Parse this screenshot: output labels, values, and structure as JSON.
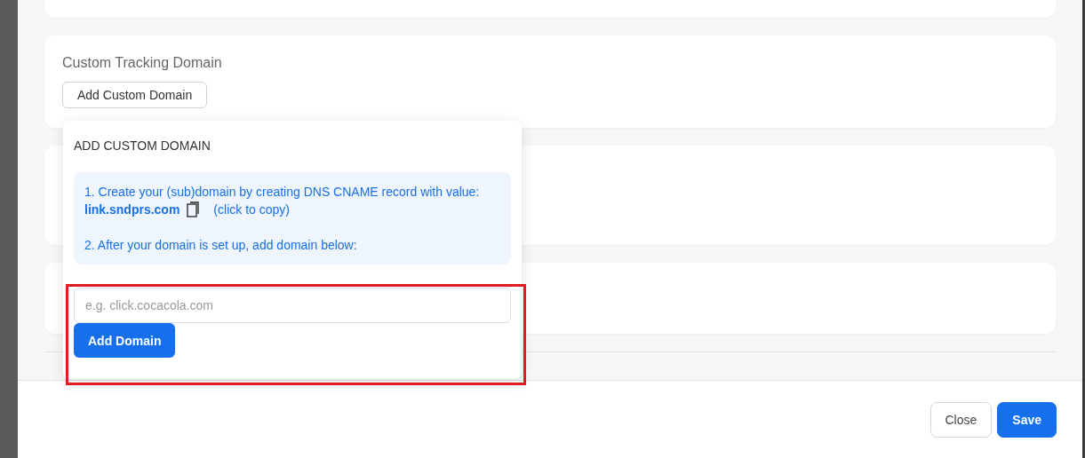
{
  "section": {
    "title": "Custom Tracking Domain",
    "button": "Add Custom Domain"
  },
  "popover": {
    "title": "ADD CUSTOM DOMAIN",
    "step_1": "1. Create your (sub)domain by creating DNS CNAME record with value:",
    "cname": "link.sndprs.com",
    "copy_hint": "(click to copy)",
    "step_2": "2. After your domain is set up, add domain below:",
    "input": {
      "placeholder": "e.g. click.cocacola.com"
    },
    "submit": "Add Domain"
  },
  "footer": {
    "buttons": [
      {
        "label": "Close",
        "kind": "secondary"
      },
      {
        "label": "Save",
        "kind": "primary"
      }
    ]
  }
}
